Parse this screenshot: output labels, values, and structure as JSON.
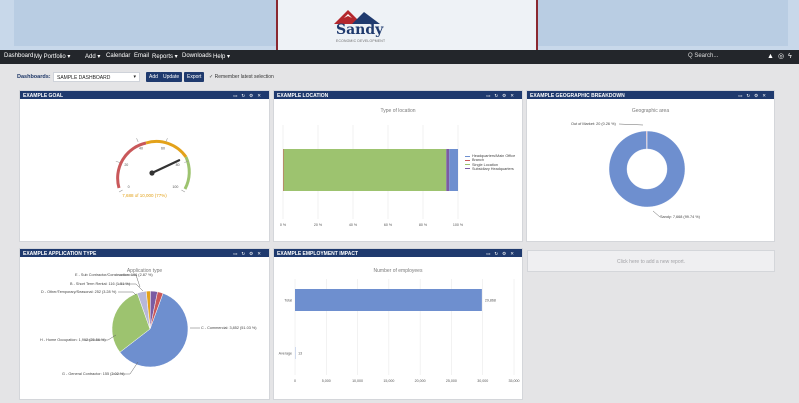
{
  "brand": {
    "name": "Sandy",
    "tagline": "ECONOMIC DEVELOPMENT"
  },
  "nav": {
    "items": [
      "Dashboard",
      "My Portfolio ▾",
      "Add ▾",
      "Calendar",
      "Email",
      "Reports ▾",
      "Downloads",
      "Help ▾"
    ],
    "search_placeholder": "Q Search...",
    "icons": [
      "bell-icon",
      "help-icon",
      "activity-icon"
    ]
  },
  "toolbar": {
    "label": "Dashboards:",
    "selected_dashboard": "SAMPLE DASHBOARD",
    "add_label": "Add",
    "update_label": "Update",
    "export_label": "Export",
    "remember_label": "✓  Remember latest selection"
  },
  "colors": {
    "header": "#1f3a6e",
    "navbar": "#23262b",
    "blue": "#6e8fcf",
    "green": "#9dc36f",
    "red": "#c9585a",
    "orange": "#e3a21a",
    "purple": "#7a5ba3"
  },
  "panels": {
    "goal": {
      "title": "EXAMPLE GOAL",
      "gauge_value": 77,
      "ticks": [
        "0",
        "20",
        "40",
        "60",
        "80",
        "100"
      ],
      "value_text": "7,688 of 10,000 (77%)"
    },
    "location": {
      "title": "EXAMPLE LOCATION",
      "chart_title": "Type of location",
      "legend": [
        "Headquarters/Main Office",
        "Branch",
        "Single Location",
        "Subsidiary Headquarters"
      ]
    },
    "geographic": {
      "title": "EXAMPLE GEOGRAPHIC BREAKDOWN",
      "chart_title": "Geographic area",
      "label_out": "Out of Market: 20 (0.26 %)",
      "label_sandy": "Sandy: 7,668 (99.74 %)"
    },
    "application": {
      "title": "EXAMPLE APPLICATION TYPE",
      "chart_title": "Application type",
      "labels": [
        "E - Sub Contractor/Construction: 196 (2.87 %)",
        "B - Short Term Rental: 116 (1.51 %)",
        "D - Other/Temporary/Seasonal: 252 (3.28 %)",
        "H - Home Occupation: 1,962 (25.56 %)",
        "G - General Contractor: 155 (2.02 %)",
        "C - Commercial: 3,852 (51.03 %)"
      ]
    },
    "employment": {
      "title": "EXAMPLE EMPLOYMENT IMPACT",
      "chart_title": "Number of employees",
      "categories": [
        "Total",
        "Average"
      ],
      "value_labels": [
        "29,868",
        "13"
      ],
      "ticks": [
        "0",
        "5,000",
        "10,000",
        "15,000",
        "20,000",
        "25,000",
        "30,000",
        "35,000"
      ]
    },
    "empty_text": "Click here to add a new report."
  },
  "chart_data": [
    {
      "type": "gauge",
      "title": "",
      "value": 7688,
      "max": 10000,
      "percent": 77,
      "ticks": [
        0,
        20,
        40,
        60,
        80,
        100
      ]
    },
    {
      "type": "bar",
      "orientation": "horizontal",
      "stacked": true,
      "title": "Type of location",
      "series": [
        {
          "name": "Headquarters/Main Office",
          "values": [
            5
          ]
        },
        {
          "name": "Branch",
          "values": [
            0.3
          ]
        },
        {
          "name": "Single Location",
          "values": [
            93
          ]
        },
        {
          "name": "Subsidiary Headquarters",
          "values": [
            1.7
          ]
        }
      ],
      "xlim": [
        0,
        100
      ],
      "xticks": [
        "0 %",
        "20 %",
        "40 %",
        "60 %",
        "80 %",
        "100 %"
      ]
    },
    {
      "type": "pie",
      "donut": true,
      "title": "Geographic area",
      "categories": [
        "Sandy",
        "Out of Market"
      ],
      "values": [
        7668,
        20
      ],
      "percents": [
        99.74,
        0.26
      ]
    },
    {
      "type": "pie",
      "title": "Application type",
      "categories": [
        "C - Commercial",
        "H - Home Occupation",
        "D - Other/Temporary/Seasonal",
        "B - Short Term Rental",
        "E - Sub Contractor/Construction",
        "G - General Contractor"
      ],
      "values": [
        3852,
        1962,
        252,
        116,
        196,
        155
      ],
      "percents": [
        51.03,
        25.56,
        3.28,
        1.51,
        2.87,
        2.02
      ]
    },
    {
      "type": "bar",
      "orientation": "horizontal",
      "title": "Number of employees",
      "categories": [
        "Total",
        "Average"
      ],
      "values": [
        29868,
        13
      ],
      "xlim": [
        0,
        35000
      ],
      "xticks": [
        0,
        5000,
        10000,
        15000,
        20000,
        25000,
        30000,
        35000
      ]
    }
  ]
}
